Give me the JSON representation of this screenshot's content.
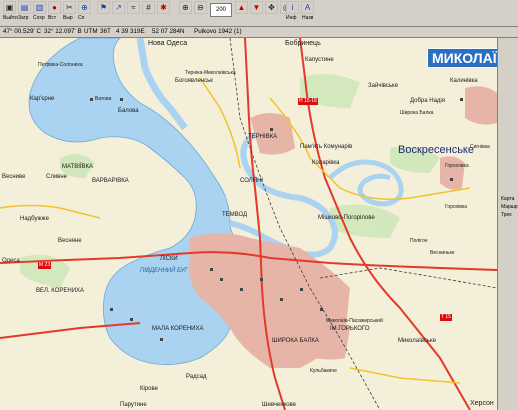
{
  "toolbar": {
    "buttons": [
      {
        "name": "exit-button",
        "glyph": "▣",
        "label": "Выйти"
      },
      {
        "name": "load-button",
        "glyph": "▤",
        "label": "Загр"
      },
      {
        "name": "save-button",
        "glyph": "▥",
        "label": "Сохр"
      },
      {
        "name": "insert-button",
        "glyph": "●",
        "label": "Вст"
      },
      {
        "name": "cut-button",
        "glyph": "✂",
        "label": "Выр"
      },
      {
        "name": "reference-button",
        "glyph": "⊕",
        "label": "Сп"
      }
    ],
    "scale_value": "200",
    "right_labels": [
      "Инф",
      "Назв"
    ]
  },
  "statusbar": {
    "lat": "47° 00.529' С",
    "lon": "32° 12.097' В",
    "utm_label": "UTM",
    "utm_zone": "36T",
    "easting": "4 39 319E",
    "northing": "52 07 284N",
    "datum": "Pulkovo 1942 (1)"
  },
  "map": {
    "city_badge": "МИКОЛАЇВ",
    "labels": [
      {
        "text": "Нова Одеса",
        "size": 7
      },
      {
        "text": "Бобринець",
        "size": 7
      },
      {
        "text": "Богоявленськ",
        "size": 6
      },
      {
        "text": "Капустине",
        "size": 6
      },
      {
        "text": "Калинівка",
        "size": 6
      },
      {
        "text": "Терніка-Миколаївська",
        "size": 5
      },
      {
        "text": "Зайчівське",
        "size": 6
      },
      {
        "text": "Добра Надія",
        "size": 6
      },
      {
        "text": "Балова",
        "size": 6
      },
      {
        "text": "Широка Балка",
        "size": 5
      },
      {
        "text": "Петрівка-Солониха",
        "size": 5
      },
      {
        "text": "Кар'єрне",
        "size": 6
      },
      {
        "text": "Ватова",
        "size": 5
      },
      {
        "text": "ТЕРНІВКА",
        "size": 6
      },
      {
        "text": "Пам'ять Комунарів",
        "size": 6
      },
      {
        "text": "Коларівка",
        "size": 6
      },
      {
        "text": "Воскресенське",
        "size": 11
      },
      {
        "text": "Сигнівка",
        "size": 5
      },
      {
        "text": "МАТВІЇВКА",
        "size": 6
      },
      {
        "text": "ВАРВАРІВКА",
        "size": 6
      },
      {
        "text": "СОЛЯНІ",
        "size": 6
      },
      {
        "text": "Сливне",
        "size": 6
      },
      {
        "text": "Гороховка",
        "size": 5
      },
      {
        "text": "Горохівка",
        "size": 5
      },
      {
        "text": "Надбужже",
        "size": 6
      },
      {
        "text": "ТЕМВОД",
        "size": 6
      },
      {
        "text": "Мішково-Погорілове",
        "size": 6
      },
      {
        "text": "Весниве",
        "size": 6
      },
      {
        "text": "Весняне",
        "size": 6
      },
      {
        "text": "Полігон",
        "size": 5
      },
      {
        "text": "Весниньке",
        "size": 5
      },
      {
        "text": "ЛІСКИ",
        "size": 6
      },
      {
        "text": "ВЕЛ. КОРЕНИХА",
        "size": 6
      },
      {
        "text": "Одеса",
        "size": 6
      },
      {
        "text": "ПІВДЕННИЙ БУГ",
        "size": 6
      },
      {
        "text": "МАЛА КОРЕНИХА",
        "size": 6
      },
      {
        "text": "Миколаїв-Пасажирський",
        "size": 5
      },
      {
        "text": "ІМ.ГОРЬКОГО",
        "size": 6
      },
      {
        "text": "Миколаївське",
        "size": 6
      },
      {
        "text": "ШИРОКА БАЛКА",
        "size": 6
      },
      {
        "text": "Кульбакине",
        "size": 5
      },
      {
        "text": "Радсад",
        "size": 6
      },
      {
        "text": "Кірове",
        "size": 6
      },
      {
        "text": "Парутине",
        "size": 6
      },
      {
        "text": "Шевченкове",
        "size": 6
      },
      {
        "text": "Херсон",
        "size": 7
      }
    ],
    "road_badges": [
      "H 15-18",
      "M 23",
      "T 15"
    ]
  },
  "right_panel": {
    "tabs": [
      "Карта",
      "Маршр",
      "Трек"
    ]
  }
}
